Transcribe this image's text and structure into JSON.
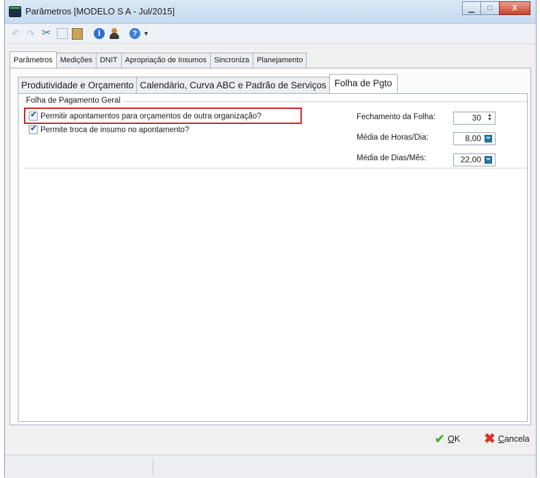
{
  "window": {
    "title": "Parâmetros [MODELO S A - Jul/2015]",
    "caption_buttons": [
      "minimize-icon",
      "maximize-icon",
      "close-icon"
    ],
    "close_glyph": "X"
  },
  "toolbar": {
    "icons": [
      "undo-icon",
      "redo-icon",
      "cut-icon",
      "copy-icon",
      "paste-icon",
      "info-icon",
      "user-icon",
      "help-icon",
      "dropdown-arrow-icon"
    ],
    "info_glyph": "i",
    "help_glyph": "?"
  },
  "tabs": [
    {
      "label": "Parâmetros",
      "active": true
    },
    {
      "label": "Medições",
      "active": false
    },
    {
      "label": "DNIT",
      "active": false
    },
    {
      "label": "Apropriação de Insumos",
      "active": false
    },
    {
      "label": "Sincroniza",
      "active": false
    },
    {
      "label": "Planejamento",
      "active": false
    }
  ],
  "subtabs": [
    {
      "label": "Produtividade e Orçamento",
      "active": false
    },
    {
      "label": "Calendário, Curva ABC e Padrão de Serviços",
      "active": false
    },
    {
      "label": "Folha de Pgto",
      "active": true
    }
  ],
  "group": {
    "title": "Folha de Pagamento Geral",
    "checkboxes": [
      {
        "label": "Permitir apontamentos para orçamentos de outra organização?",
        "checked": true,
        "highlighted": true
      },
      {
        "label": "Permite troca de insumo no apontamento?",
        "checked": true,
        "highlighted": false
      }
    ],
    "fields": [
      {
        "label": "Fechamento da Folha:",
        "value": "30",
        "control": "spinner"
      },
      {
        "label": "Média de Horas/Dia:",
        "value": "8,00",
        "control": "calculator"
      },
      {
        "label": "Média de Dias/Mês:",
        "value": "22,00",
        "control": "calculator"
      }
    ]
  },
  "buttons": {
    "ok_mnemonic": "O",
    "ok_rest": "K",
    "cancel_mnemonic": "C",
    "cancel_rest": "ancela"
  },
  "colors": {
    "highlight_border": "#d81e1e",
    "ok_icon": "#4caf30",
    "cancel_icon": "#d9342b",
    "tab_border": "#a6b1bd"
  }
}
